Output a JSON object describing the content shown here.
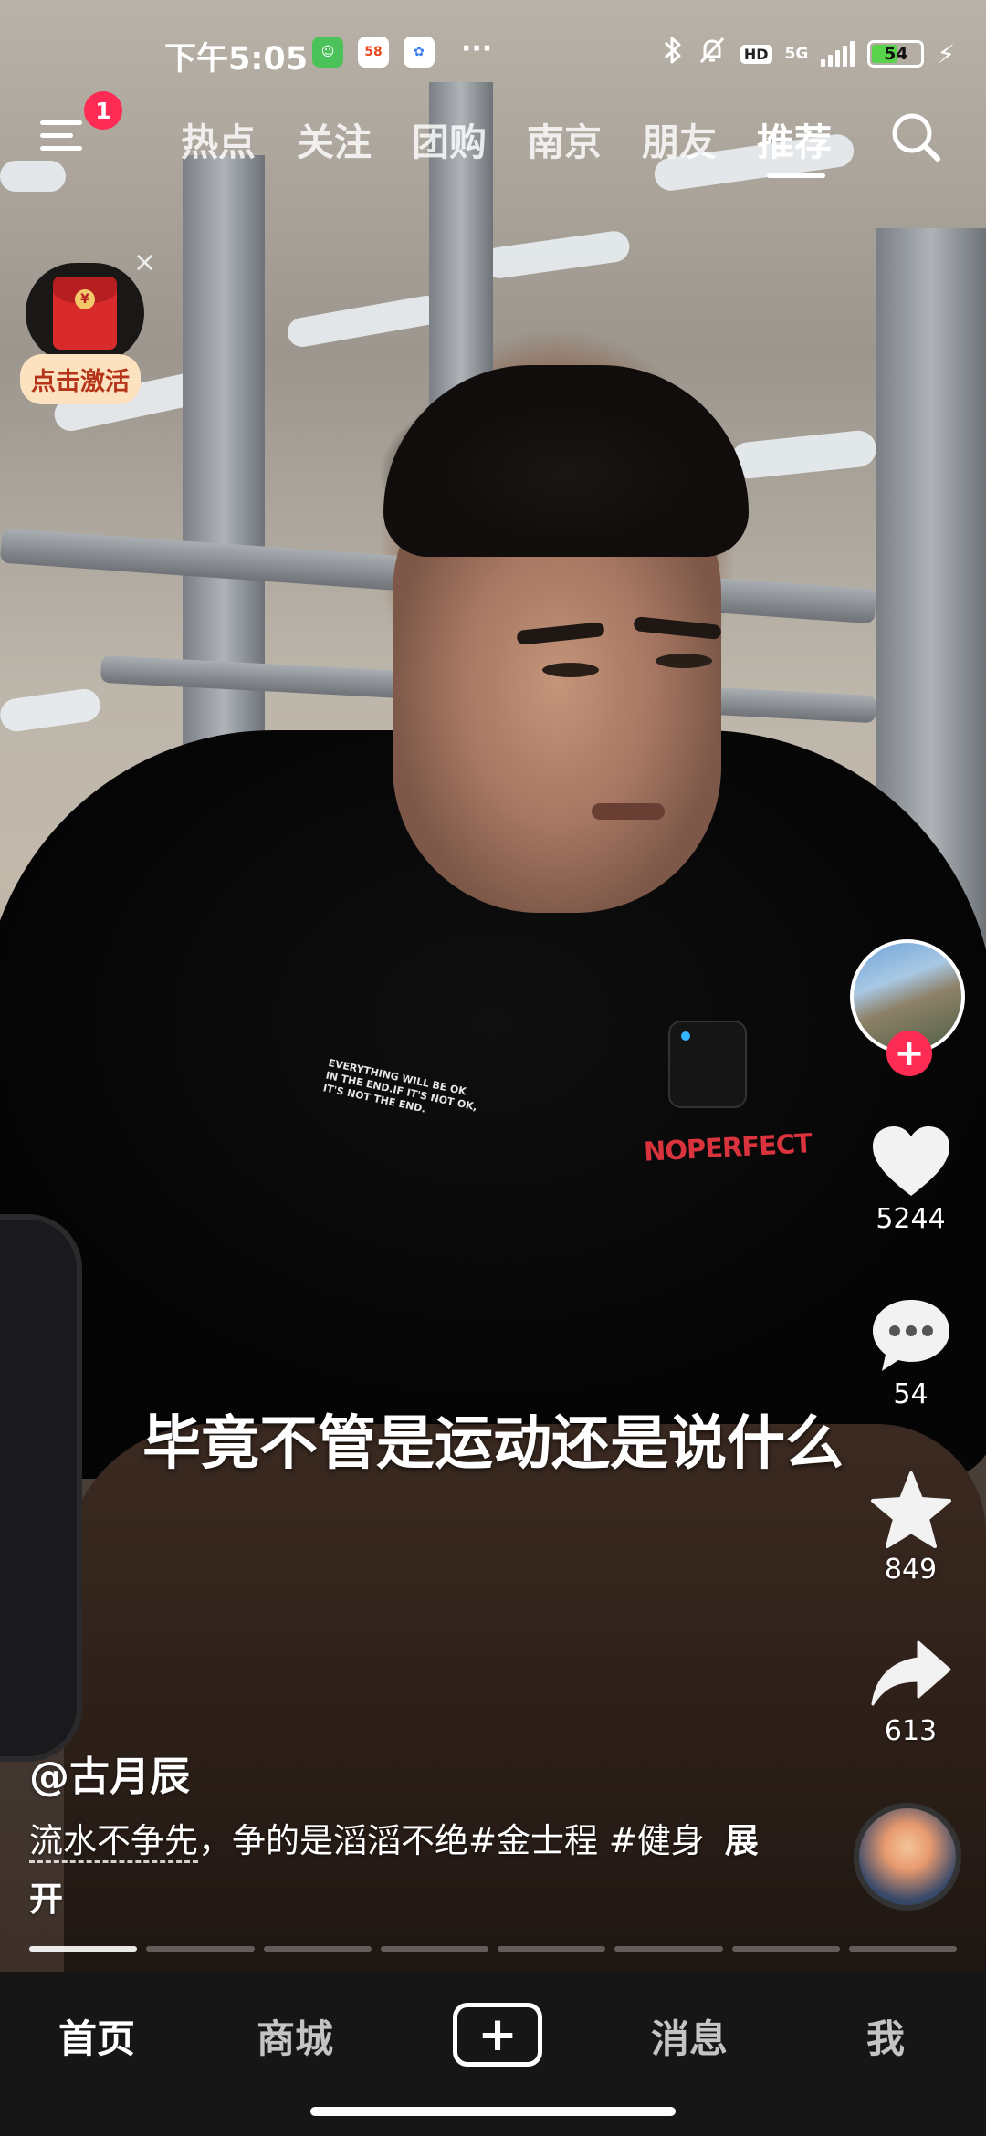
{
  "status_bar": {
    "time": "下午5:05",
    "apps": [
      "58"
    ],
    "more": "···",
    "hd": "HD",
    "network": "5G",
    "battery": "54",
    "battery_percent": 54
  },
  "top_nav": {
    "badge": "1",
    "tabs": [
      {
        "label": "热点"
      },
      {
        "label": "关注"
      },
      {
        "label": "团购"
      },
      {
        "label": "南京"
      },
      {
        "label": "朋友"
      },
      {
        "label": "推荐",
        "active": true
      }
    ]
  },
  "red_packet": {
    "label": "点击激活",
    "close": "×"
  },
  "video": {
    "shirt_text": "EVERYTHING WILL BE OK IN THE END.IF IT'S NOT OK, IT'S NOT THE END.",
    "brand": "NOPERFECT",
    "subtitle": "毕竟不管是运动还是说什么"
  },
  "actions": {
    "follow": "+",
    "likes": "5244",
    "comments": "54",
    "favorites": "849",
    "shares": "613"
  },
  "post": {
    "author": "@古月辰",
    "caption_linked": "流水不争先",
    "caption_rest": "，争的是滔滔不绝#金士程 #健身",
    "expand": "展开",
    "progress_segments": 8,
    "progress_active_index": 0
  },
  "bottom_nav": {
    "items": [
      {
        "label": "首页",
        "active": true
      },
      {
        "label": "商城"
      },
      {
        "label": "消息"
      },
      {
        "label": "我"
      }
    ],
    "plus": "+"
  },
  "colors": {
    "accent": "#fe2c55",
    "battery": "#59d34b",
    "brand_red": "#d9333d"
  }
}
